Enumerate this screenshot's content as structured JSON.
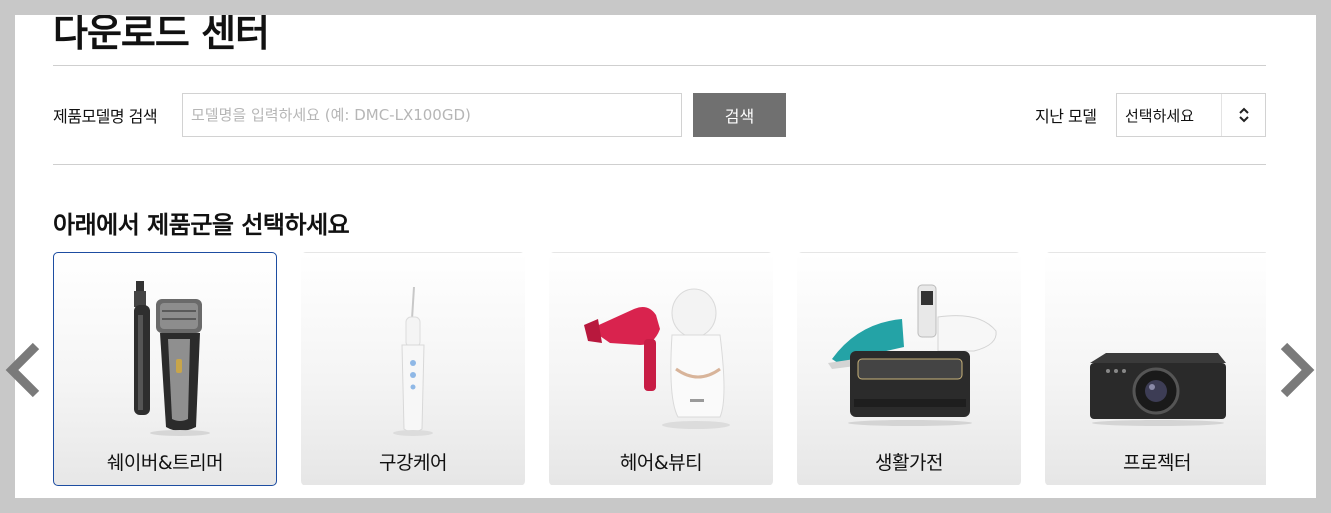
{
  "page": {
    "title": "다운로드 센터"
  },
  "search": {
    "label": "제품모델명 검색",
    "placeholder": "모델명을 입력하세요 (예: DMC-LX100GD)",
    "button_label": "검색"
  },
  "past_model": {
    "label": "지난 모델",
    "selected": "선택하세요"
  },
  "category_section": {
    "prompt": "아래에서 제품군을 선택하세요",
    "categories": [
      {
        "label": "쉐이버&트리머",
        "selected": true
      },
      {
        "label": "구강케어",
        "selected": false
      },
      {
        "label": "헤어&뷰티",
        "selected": false
      },
      {
        "label": "생활가전",
        "selected": false
      },
      {
        "label": "프로젝터",
        "selected": false
      }
    ]
  },
  "colors": {
    "accent_border": "#1d4da1",
    "button_gray": "#707070",
    "frame_gray": "#c8c8c8"
  },
  "icons": {
    "prev": "chevron-left-icon",
    "next": "chevron-right-icon",
    "select": "up-down-chevron-icon"
  }
}
